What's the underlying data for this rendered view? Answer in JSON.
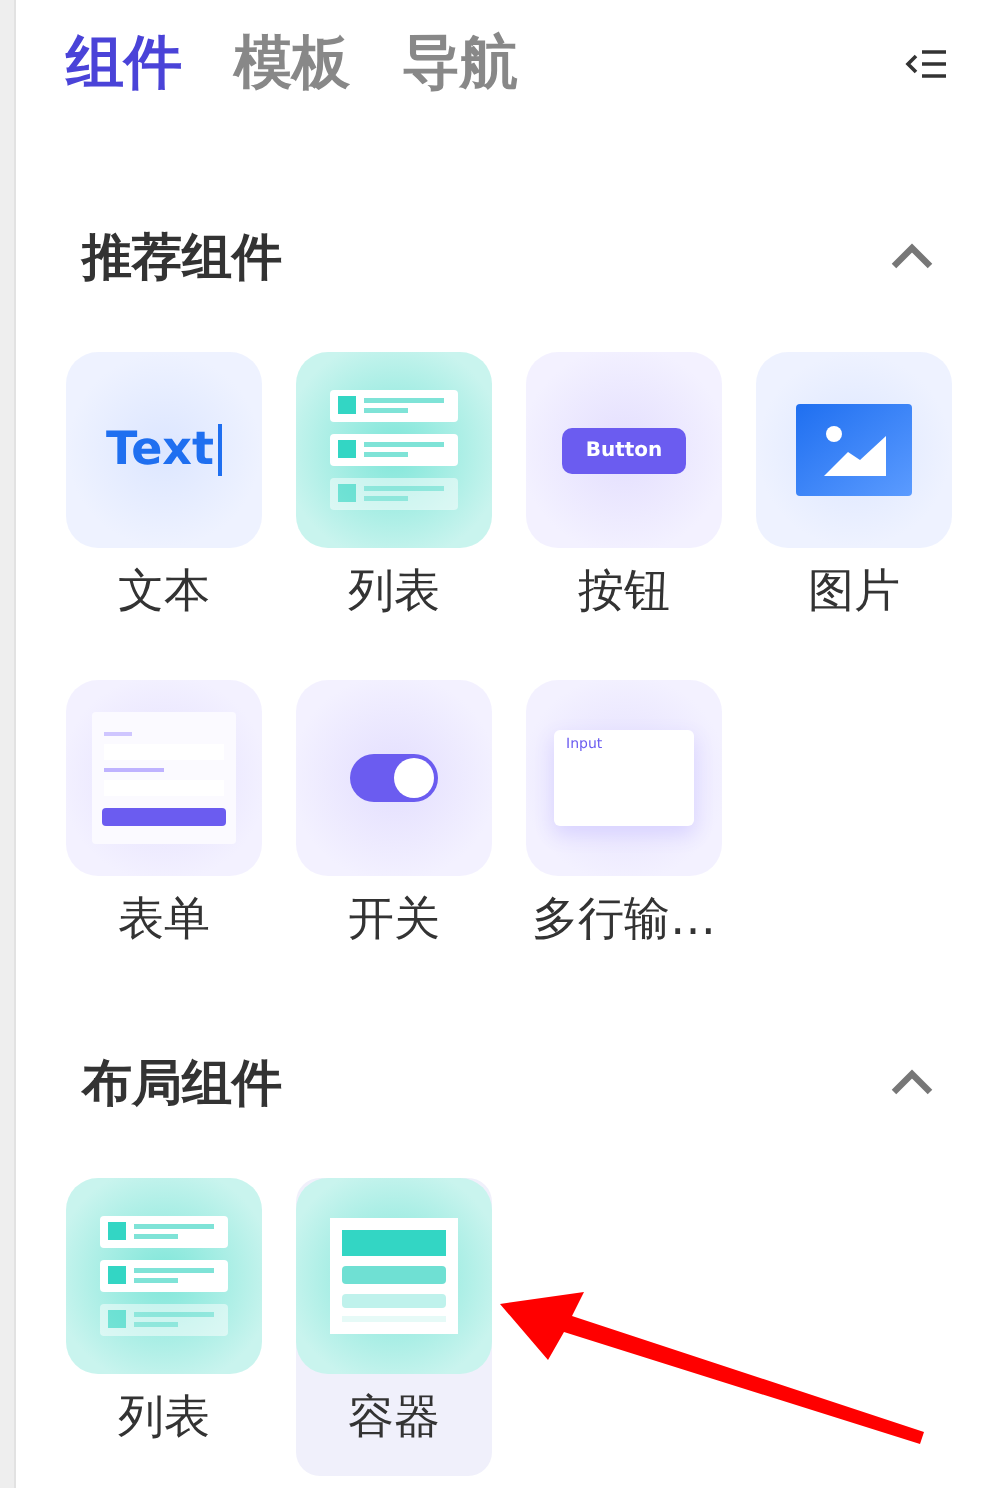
{
  "tabs": [
    {
      "label": "组件",
      "selected": true
    },
    {
      "label": "模板",
      "selected": false
    },
    {
      "label": "导航",
      "selected": false
    }
  ],
  "sections": [
    {
      "title": "推荐组件",
      "expanded": true,
      "items": [
        {
          "kind": "text",
          "label": "文本",
          "preview_text": "Text",
          "selected": false
        },
        {
          "kind": "list",
          "label": "列表",
          "selected": false
        },
        {
          "kind": "button",
          "label": "按钮",
          "preview_text": "Button",
          "selected": false
        },
        {
          "kind": "image",
          "label": "图片",
          "selected": false
        },
        {
          "kind": "form",
          "label": "表单",
          "selected": false
        },
        {
          "kind": "switch",
          "label": "开关",
          "on": true,
          "selected": false
        },
        {
          "kind": "textarea",
          "label": "多行输…",
          "preview_text": "Input",
          "selected": false
        }
      ]
    },
    {
      "title": "布局组件",
      "expanded": true,
      "items": [
        {
          "kind": "list",
          "label": "列表",
          "selected": false
        },
        {
          "kind": "container",
          "label": "容器",
          "selected": true
        }
      ]
    }
  ],
  "annotation_arrow": true
}
